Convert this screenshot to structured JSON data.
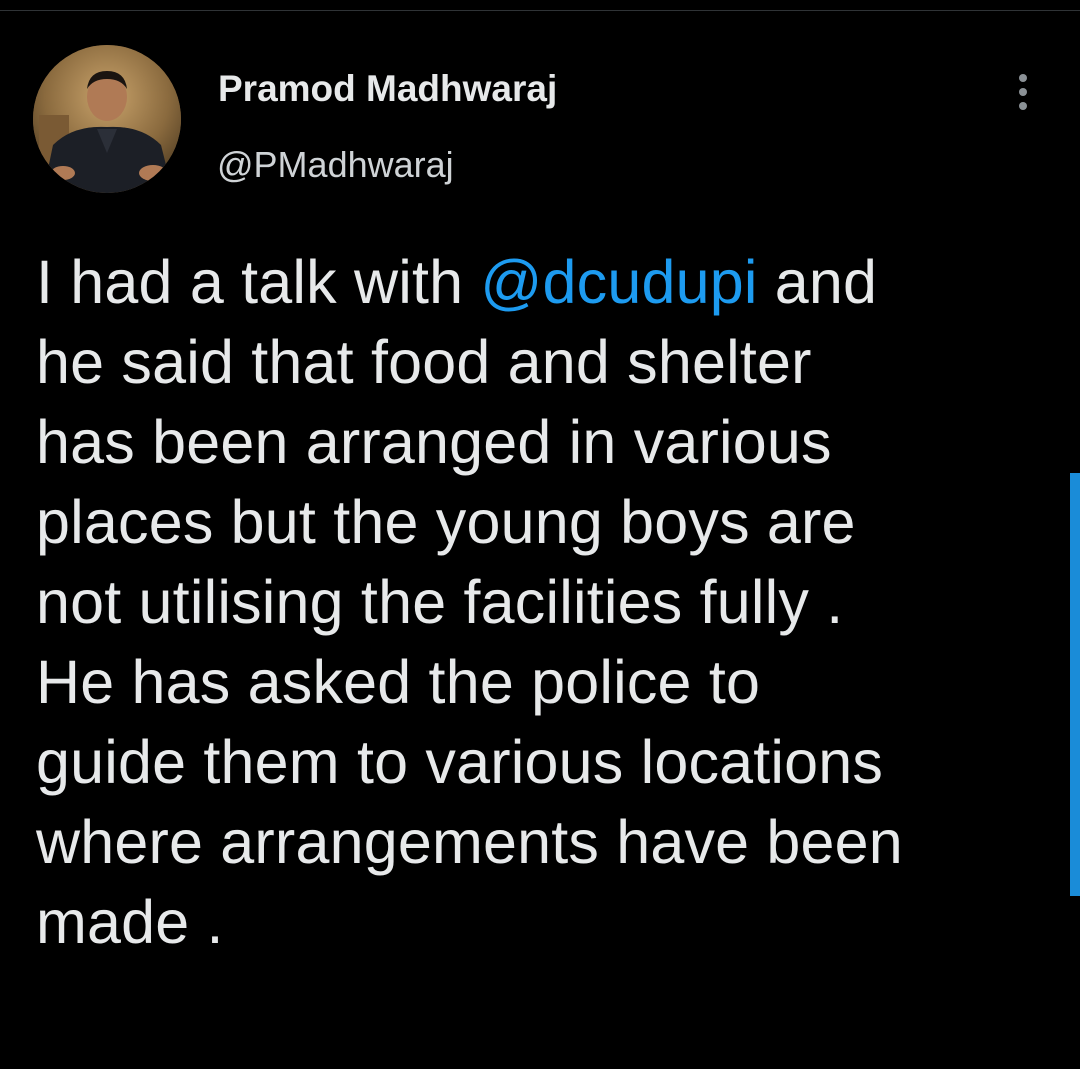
{
  "tweet": {
    "author": {
      "display_name": "Pramod Madhwaraj",
      "handle": "@PMadhwaraj",
      "avatar_icon": "profile-photo"
    },
    "more_icon": "more-vertical-icon",
    "text_lines": [
      {
        "before": "I had a talk with ",
        "mention": "@dcudupi",
        "after": " and"
      },
      {
        "text": "he said that food and shelter"
      },
      {
        "text": "has been arranged in various"
      },
      {
        "text": "places but the young boys are"
      },
      {
        "text": "not utilising the facilities fully ."
      },
      {
        "text": "He has asked the police to"
      },
      {
        "text": "guide them to various locations"
      },
      {
        "text": "where arrangements have been"
      },
      {
        "text": "made ."
      }
    ]
  },
  "colors": {
    "background": "#000000",
    "text": "#e7e9ea",
    "mention": "#1d9bf0",
    "scrollbar": "#1a8cd8"
  }
}
